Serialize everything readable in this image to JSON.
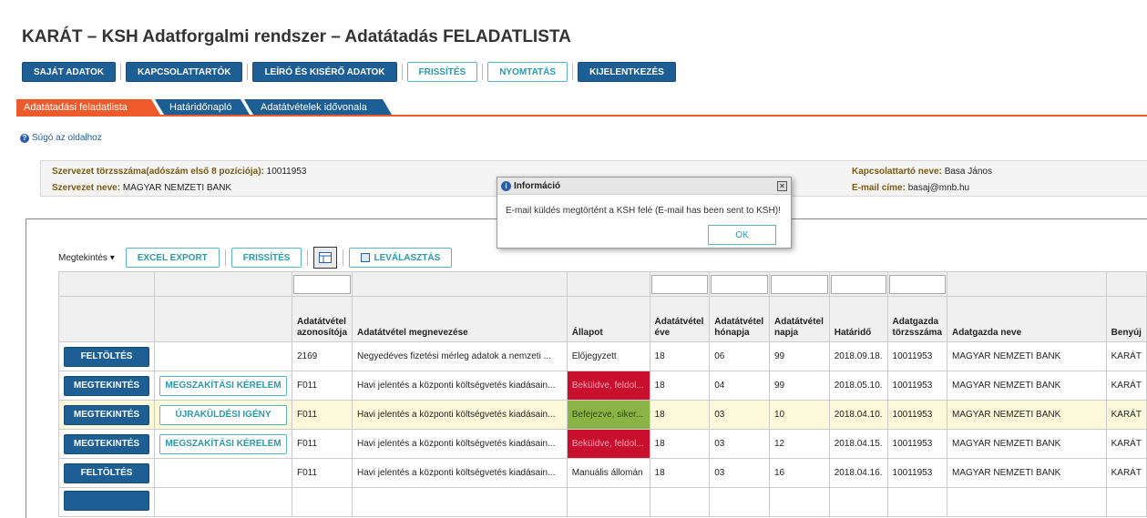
{
  "title": "KARÁT – KSH Adatforgalmi rendszer – Adatátadás FELADATLISTA",
  "toolbar": {
    "own_data": "SAJÁT ADATOK",
    "contacts": "KAPCSOLATTARTÓK",
    "descriptive": "LEÍRÓ ÉS KISÉRŐ ADATOK",
    "refresh": "FRISSÍTÉS",
    "print": "NYOMTATÁS",
    "logout": "KIJELENTKEZÉS"
  },
  "tabs": [
    "Adatátadási feladatlista",
    "Határidőnapló",
    "Adatátvételek idővonala"
  ],
  "help_link": "Súgó az oldalhoz",
  "org": {
    "tax_label": "Szervezet törzsszáma(adószám első 8 pozíciója):",
    "tax_value": "10011953",
    "name_label": "Szervezet neve:",
    "name_value": "MAGYAR NEMZETI BANK",
    "contact_label": "Kapcsolattartó neve:",
    "contact_value": "Basa János",
    "email_label": "E-mail címe:",
    "email_value": "basaj@mnb.hu"
  },
  "grid_toolbar": {
    "view": "Megtekintés ▾",
    "excel": "EXCEL EXPORT",
    "refresh": "FRISSÍTÉS",
    "detach": "LEVÁLASZTÁS"
  },
  "columns": {
    "id": "Adatátvétel azonosítója",
    "name": "Adatátvétel megnevezése",
    "status": "Állapot",
    "year": "Adatátvétel éve",
    "month": "Adatátvétel hónapja",
    "day": "Adatátvétel napja",
    "deadline": "Határidő",
    "org_id": "Adatgazda törzsszáma",
    "org_name": "Adatgazda neve",
    "submitter": "Benyúj"
  },
  "rows": [
    {
      "action": "FELTÖLTÉS",
      "action2": "",
      "id": "2169",
      "name": "Negyedéves fizetési mérleg adatok a nemzeti ...",
      "status": "Előjegyzett",
      "status_color": "none",
      "year": "18",
      "month": "06",
      "day": "99",
      "deadline": "2018.09.18.",
      "org_id": "10011953",
      "org_name": "MAGYAR NEMZETI BANK",
      "submitter": "KARÁT"
    },
    {
      "action": "MEGTEKINTÉS",
      "action2": "MEGSZAKÍTÁSI KÉRELEM",
      "id": "F011",
      "name": "Havi jelentés a központi költségvetés kiadásain...",
      "status": "Beküldve, feldol...",
      "status_color": "red",
      "year": "18",
      "month": "04",
      "day": "99",
      "deadline": "2018.05.10.",
      "org_id": "10011953",
      "org_name": "MAGYAR NEMZETI BANK",
      "submitter": "KARÁT"
    },
    {
      "action": "MEGTEKINTÉS",
      "action2": "ÚJRAKÜLDÉSI IGÉNY",
      "id": "F011",
      "name": "Havi jelentés a központi költségvetés kiadásain...",
      "status": "Befejezve, siker...",
      "status_color": "green",
      "year": "18",
      "month": "03",
      "day": "10",
      "deadline": "2018.04.10.",
      "org_id": "10011953",
      "org_name": "MAGYAR NEMZETI BANK",
      "submitter": "KARÁT"
    },
    {
      "action": "MEGTEKINTÉS",
      "action2": "MEGSZAKÍTÁSI KÉRELEM",
      "id": "F011",
      "name": "Havi jelentés a központi költségvetés kiadásain...",
      "status": "Beküldve, feldol...",
      "status_color": "red",
      "year": "18",
      "month": "03",
      "day": "12",
      "deadline": "2018.04.15.",
      "org_id": "10011953",
      "org_name": "MAGYAR NEMZETI BANK",
      "submitter": "KARÁT"
    },
    {
      "action": "FELTÖLTÉS",
      "action2": "",
      "id": "F011",
      "name": "Havi jelentés a központi költségvetés kiadásain...",
      "status": "Manuális állomán",
      "status_color": "none",
      "year": "18",
      "month": "03",
      "day": "16",
      "deadline": "2018.04.16.",
      "org_id": "10011953",
      "org_name": "MAGYAR NEMZETI BANK",
      "submitter": "KARÁT"
    }
  ],
  "dialog": {
    "title": "Információ",
    "message": "E-mail küldés megtörtént a KSH felé (E-mail has been sent to KSH)!",
    "ok": "OK"
  },
  "colors": {
    "brand_blue": "#1d5e94",
    "tab_orange": "#ee5a2a",
    "teal": "#2a9aa8",
    "status_red": "#c8102e",
    "status_green": "#8ab446"
  }
}
